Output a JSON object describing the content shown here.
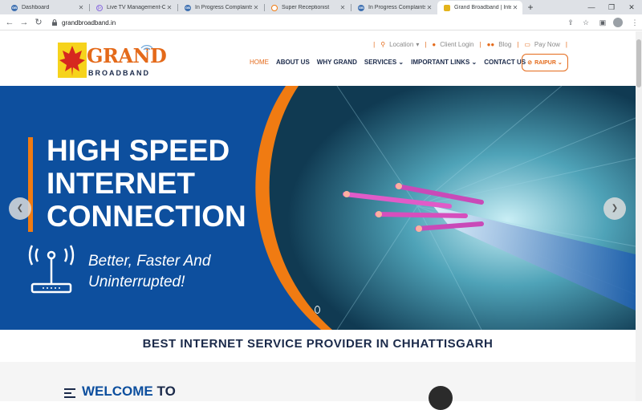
{
  "browser": {
    "tabs": [
      {
        "title": "Dashboard",
        "icon": "grand-favicon-icon",
        "color": "#3d6fb0"
      },
      {
        "title": "Live TV Management-Cl",
        "icon": "play-favicon-icon",
        "color": "#8a6be0"
      },
      {
        "title": "In Progress Complaints",
        "icon": "grand-favicon-icon",
        "color": "#3d6fb0"
      },
      {
        "title": "Super Receptionist",
        "icon": "clock-favicon-icon",
        "color": "#f07b12"
      },
      {
        "title": "In Progress Complaints",
        "icon": "grand-favicon-icon",
        "color": "#3d6fb0"
      },
      {
        "title": "Grand Broadband | Inte",
        "icon": "grand-leaf-favicon-icon",
        "color": "#e4b41c"
      }
    ],
    "url": "grandbroadband.in"
  },
  "logo": {
    "grand": "GRAND",
    "broadband": "BROADBAND"
  },
  "topbar": {
    "location": "Location",
    "client_login": "Client Login",
    "blog": "Blog",
    "pay_now": "Pay Now"
  },
  "nav": {
    "home": "HOME",
    "about": "ABOUT US",
    "why": "WHY GRAND",
    "services": "SERVICES",
    "links": "IMPORTANT LINKS",
    "contact": "CONTACT US",
    "city": "RAIPUR"
  },
  "hero": {
    "line1": "HIGH SPEED",
    "line2": "INTERNET",
    "line3": "CONNECTION",
    "tag1": "Better, Faster And",
    "tag2": "Uninterrupted!"
  },
  "band_title": "BEST INTERNET SERVICE PROVIDER IN CHHATTISGARH",
  "welcome": {
    "part1": "WELCOME",
    "part2": "TO"
  },
  "colors": {
    "brand_orange": "#e46a1a",
    "brand_navy": "#1b2a4a",
    "hero_blue": "#0d4f9e"
  }
}
